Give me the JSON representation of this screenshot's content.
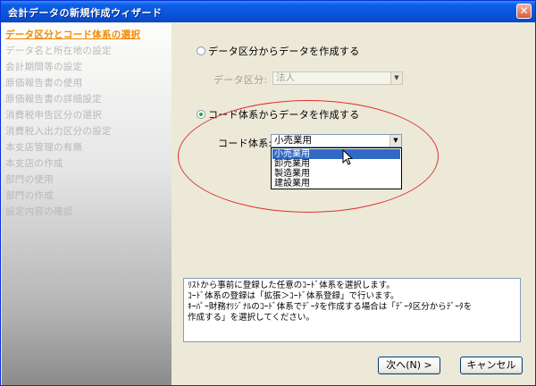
{
  "window": {
    "title": "会計データの新規作成ウィザード",
    "close_glyph": "✕"
  },
  "steps": [
    {
      "label": "データ区分とコード体系の選択",
      "active": true
    },
    {
      "label": "データ名と所在地の設定",
      "active": false
    },
    {
      "label": "会計期間等の設定",
      "active": false
    },
    {
      "label": "原価報告書の使用",
      "active": false
    },
    {
      "label": "原価報告書の詳細設定",
      "active": false
    },
    {
      "label": "消費税申告区分の選択",
      "active": false
    },
    {
      "label": "消費税入出力区分の設定",
      "active": false
    },
    {
      "label": "本支店管理の有無",
      "active": false
    },
    {
      "label": "本支店の作成",
      "active": false
    },
    {
      "label": "部門の使用",
      "active": false
    },
    {
      "label": "部門の作成",
      "active": false
    },
    {
      "label": "設定内容の確認",
      "active": false
    }
  ],
  "options": {
    "from_data_class": {
      "label": "データ区分からデータを作成する",
      "checked": false,
      "field_label": "データ区分:",
      "value": "法人"
    },
    "from_code_system": {
      "label": "コード体系からデータを作成する",
      "checked": true,
      "field_label": "コード体系:",
      "value": "小売業用",
      "dropdown_items": [
        "小売業用",
        "卸売業用",
        "製造業用",
        "建設業用"
      ],
      "highlighted_index": 0
    }
  },
  "description": "ﾘｽﾄから事前に登録した任意のｺｰﾄﾞ体系を選択します。\nｺｰﾄﾞ体系の登録は「拡張＞ｺｰﾄﾞ体系登録」で行います。\nｷｰﾊﾟｰ財務ｵﾘｼﾞﾅﾙのｺｰﾄﾞ体系でﾃﾞｰﾀを作成する場合は「ﾃﾞｰﾀ区分からﾃﾞｰﾀを\n作成する」を選択してください。",
  "buttons": {
    "next": "次へ(N) >",
    "cancel": "キャンセル"
  },
  "icons": {
    "dropdown": "▼"
  }
}
